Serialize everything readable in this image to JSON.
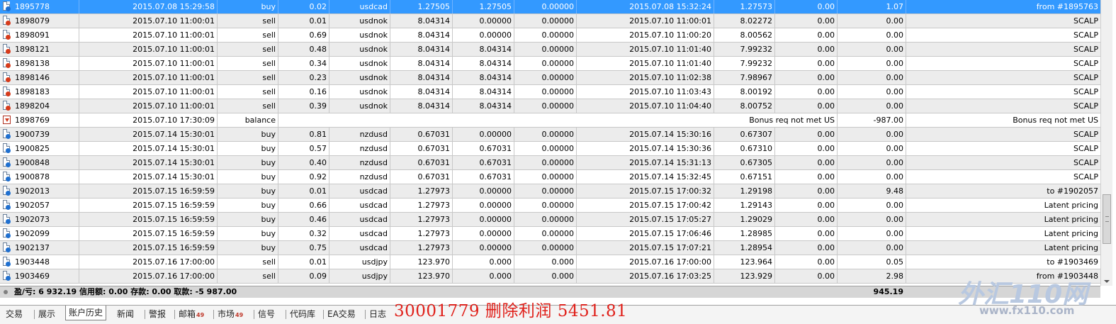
{
  "rows": [
    {
      "icon": "buy",
      "ticket": "1895778",
      "time": "2015.07.08 15:29:58",
      "type": "buy",
      "size": "0.02",
      "symbol": "usdcad",
      "price": "1.27505",
      "sl": "1.27505",
      "tp": "0.00000",
      "close_time": "2015.07.08 15:32:24",
      "close_price": "1.27573",
      "swap": "0.00",
      "profit": "1.07",
      "comment": "from #1895763",
      "selected": true
    },
    {
      "icon": "sell",
      "ticket": "1898079",
      "time": "2015.07.10 11:00:01",
      "type": "sell",
      "size": "0.01",
      "symbol": "usdnok",
      "price": "8.04314",
      "sl": "0.00000",
      "tp": "0.00000",
      "close_time": "2015.07.10 11:00:01",
      "close_price": "8.02272",
      "swap": "0.00",
      "profit": "0.00",
      "comment": "SCALP"
    },
    {
      "icon": "sell",
      "ticket": "1898091",
      "time": "2015.07.10 11:00:01",
      "type": "sell",
      "size": "0.69",
      "symbol": "usdnok",
      "price": "8.04314",
      "sl": "0.00000",
      "tp": "0.00000",
      "close_time": "2015.07.10 11:00:20",
      "close_price": "8.00562",
      "swap": "0.00",
      "profit": "0.00",
      "comment": "SCALP"
    },
    {
      "icon": "sell",
      "ticket": "1898121",
      "time": "2015.07.10 11:00:01",
      "type": "sell",
      "size": "0.48",
      "symbol": "usdnok",
      "price": "8.04314",
      "sl": "8.04314",
      "tp": "0.00000",
      "close_time": "2015.07.10 11:01:40",
      "close_price": "7.99232",
      "swap": "0.00",
      "profit": "0.00",
      "comment": "SCALP"
    },
    {
      "icon": "sell",
      "ticket": "1898138",
      "time": "2015.07.10 11:00:01",
      "type": "sell",
      "size": "0.34",
      "symbol": "usdnok",
      "price": "8.04314",
      "sl": "8.04314",
      "tp": "0.00000",
      "close_time": "2015.07.10 11:01:40",
      "close_price": "7.99232",
      "swap": "0.00",
      "profit": "0.00",
      "comment": "SCALP"
    },
    {
      "icon": "sell",
      "ticket": "1898146",
      "time": "2015.07.10 11:00:01",
      "type": "sell",
      "size": "0.23",
      "symbol": "usdnok",
      "price": "8.04314",
      "sl": "8.04314",
      "tp": "0.00000",
      "close_time": "2015.07.10 11:02:38",
      "close_price": "7.98967",
      "swap": "0.00",
      "profit": "0.00",
      "comment": "SCALP"
    },
    {
      "icon": "sell",
      "ticket": "1898183",
      "time": "2015.07.10 11:00:01",
      "type": "sell",
      "size": "0.16",
      "symbol": "usdnok",
      "price": "8.04314",
      "sl": "8.04314",
      "tp": "0.00000",
      "close_time": "2015.07.10 11:03:43",
      "close_price": "8.00192",
      "swap": "0.00",
      "profit": "0.00",
      "comment": "SCALP"
    },
    {
      "icon": "sell",
      "ticket": "1898204",
      "time": "2015.07.10 11:00:01",
      "type": "sell",
      "size": "0.39",
      "symbol": "usdnok",
      "price": "8.04314",
      "sl": "8.04314",
      "tp": "0.00000",
      "close_time": "2015.07.10 11:04:40",
      "close_price": "8.00752",
      "swap": "0.00",
      "profit": "0.00",
      "comment": "SCALP"
    },
    {
      "icon": "balance",
      "ticket": "1898769",
      "time": "2015.07.10 17:30:09",
      "type": "balance",
      "span": "Bonus req not met US",
      "profit": "-987.00",
      "comment": "Bonus req not met US"
    },
    {
      "icon": "buy",
      "ticket": "1900739",
      "time": "2015.07.14 15:30:01",
      "type": "buy",
      "size": "0.81",
      "symbol": "nzdusd",
      "price": "0.67031",
      "sl": "0.00000",
      "tp": "0.00000",
      "close_time": "2015.07.14 15:30:16",
      "close_price": "0.67307",
      "swap": "0.00",
      "profit": "0.00",
      "comment": "SCALP"
    },
    {
      "icon": "buy",
      "ticket": "1900825",
      "time": "2015.07.14 15:30:01",
      "type": "buy",
      "size": "0.57",
      "symbol": "nzdusd",
      "price": "0.67031",
      "sl": "0.67031",
      "tp": "0.00000",
      "close_time": "2015.07.14 15:30:36",
      "close_price": "0.67310",
      "swap": "0.00",
      "profit": "0.00",
      "comment": "SCALP"
    },
    {
      "icon": "buy",
      "ticket": "1900848",
      "time": "2015.07.14 15:30:01",
      "type": "buy",
      "size": "0.40",
      "symbol": "nzdusd",
      "price": "0.67031",
      "sl": "0.67031",
      "tp": "0.00000",
      "close_time": "2015.07.14 15:31:13",
      "close_price": "0.67305",
      "swap": "0.00",
      "profit": "0.00",
      "comment": "SCALP"
    },
    {
      "icon": "buy",
      "ticket": "1900878",
      "time": "2015.07.14 15:30:01",
      "type": "buy",
      "size": "0.92",
      "symbol": "nzdusd",
      "price": "0.67031",
      "sl": "0.67031",
      "tp": "0.00000",
      "close_time": "2015.07.14 15:32:45",
      "close_price": "0.67151",
      "swap": "0.00",
      "profit": "0.00",
      "comment": "SCALP"
    },
    {
      "icon": "buy",
      "ticket": "1902013",
      "time": "2015.07.15 16:59:59",
      "type": "buy",
      "size": "0.01",
      "symbol": "usdcad",
      "price": "1.27973",
      "sl": "0.00000",
      "tp": "0.00000",
      "close_time": "2015.07.15 17:00:32",
      "close_price": "1.29198",
      "swap": "0.00",
      "profit": "9.48",
      "comment": "to #1902057"
    },
    {
      "icon": "buy",
      "ticket": "1902057",
      "time": "2015.07.15 16:59:59",
      "type": "buy",
      "size": "0.66",
      "symbol": "usdcad",
      "price": "1.27973",
      "sl": "0.00000",
      "tp": "0.00000",
      "close_time": "2015.07.15 17:00:42",
      "close_price": "1.29143",
      "swap": "0.00",
      "profit": "0.00",
      "comment": "Latent pricing"
    },
    {
      "icon": "buy",
      "ticket": "1902073",
      "time": "2015.07.15 16:59:59",
      "type": "buy",
      "size": "0.46",
      "symbol": "usdcad",
      "price": "1.27973",
      "sl": "0.00000",
      "tp": "0.00000",
      "close_time": "2015.07.15 17:05:27",
      "close_price": "1.29029",
      "swap": "0.00",
      "profit": "0.00",
      "comment": "Latent pricing"
    },
    {
      "icon": "buy",
      "ticket": "1902099",
      "time": "2015.07.15 16:59:59",
      "type": "buy",
      "size": "0.32",
      "symbol": "usdcad",
      "price": "1.27973",
      "sl": "0.00000",
      "tp": "0.00000",
      "close_time": "2015.07.15 17:06:46",
      "close_price": "1.28985",
      "swap": "0.00",
      "profit": "0.00",
      "comment": "Latent pricing"
    },
    {
      "icon": "buy",
      "ticket": "1902137",
      "time": "2015.07.15 16:59:59",
      "type": "buy",
      "size": "0.75",
      "symbol": "usdcad",
      "price": "1.27973",
      "sl": "0.00000",
      "tp": "0.00000",
      "close_time": "2015.07.15 17:07:21",
      "close_price": "1.28954",
      "swap": "0.00",
      "profit": "0.00",
      "comment": "Latent pricing"
    },
    {
      "icon": "buy",
      "ticket": "1903448",
      "time": "2015.07.16 17:00:00",
      "type": "sell",
      "size": "0.01",
      "symbol": "usdjpy",
      "price": "123.970",
      "sl": "0.000",
      "tp": "0.000",
      "close_time": "2015.07.16 17:00:00",
      "close_price": "123.964",
      "swap": "0.00",
      "profit": "0.05",
      "comment": "to #1903469"
    },
    {
      "icon": "buy",
      "ticket": "1903469",
      "time": "2015.07.16 17:00:00",
      "type": "sell",
      "size": "0.09",
      "symbol": "usdjpy",
      "price": "123.970",
      "sl": "0.000",
      "tp": "0.000",
      "close_time": "2015.07.16 17:03:25",
      "close_price": "123.929",
      "swap": "0.00",
      "profit": "2.98",
      "comment": "from #1903448"
    }
  ],
  "summary": {
    "text": "盈/亏: 6 932.19  信用额: 0.00  存款: 0.00  取款: -5 987.00",
    "total_profit": "945.19"
  },
  "tabs": [
    {
      "label": "交易"
    },
    {
      "label": "展示"
    },
    {
      "label": "账户历史",
      "active": true
    },
    {
      "label": "新闻"
    },
    {
      "label": "警报"
    },
    {
      "label": "邮箱",
      "count": "49"
    },
    {
      "label": "市场",
      "count": "49"
    },
    {
      "label": "信号"
    },
    {
      "label": "代码库"
    },
    {
      "label": "EA交易"
    },
    {
      "label": "日志"
    }
  ],
  "overlay_text": "30001779 删除利润 5451.81",
  "watermark": {
    "logo": "外汇110网",
    "url": "www.fx110.com"
  },
  "colors": {
    "selected_row": "#3399ff",
    "overlay": "#e0201a",
    "buy_badge": "#1e6fd0",
    "sell_badge": "#d63a1a"
  }
}
